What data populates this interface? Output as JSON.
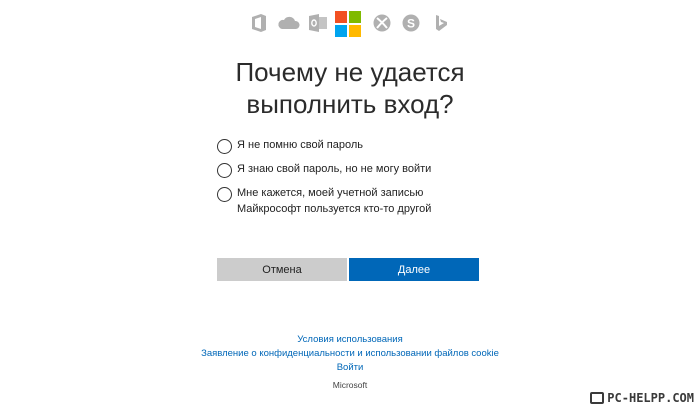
{
  "products": [
    {
      "name": "office-icon",
      "color": "#b0b0b0"
    },
    {
      "name": "onedrive-icon",
      "color": "#b0b0b0"
    },
    {
      "name": "outlook-icon",
      "color": "#b0b0b0"
    },
    {
      "name": "microsoft-logo",
      "colors": [
        "#f25022",
        "#7fba00",
        "#00a4ef",
        "#ffb900"
      ]
    },
    {
      "name": "xbox-icon",
      "color": "#b0b0b0"
    },
    {
      "name": "skype-icon",
      "color": "#b0b0b0"
    },
    {
      "name": "bing-icon",
      "color": "#b0b0b0"
    }
  ],
  "title": {
    "line1": "Почему не удается",
    "line2": "выполнить вход?"
  },
  "options": [
    {
      "lines": [
        "Я не помню свой пароль"
      ],
      "selected": false
    },
    {
      "lines": [
        "Я знаю свой пароль, но не могу войти"
      ],
      "selected": false
    },
    {
      "lines": [
        "Мне кажется, моей учетной записью",
        "Майкрософт пользуется кто-то другой"
      ],
      "selected": false
    }
  ],
  "buttons": {
    "cancel_label": "Отмена",
    "next_label": "Далее"
  },
  "colors": {
    "accent": "#0067b8",
    "secondary_button": "#cccccc"
  },
  "footer": {
    "terms": "Условия использования",
    "privacy": "Заявление о конфиденциальности и использовании файлов cookie",
    "signin": "Войти",
    "brand": "Microsoft"
  },
  "watermark": {
    "text": "PC-HELPP.COM"
  }
}
